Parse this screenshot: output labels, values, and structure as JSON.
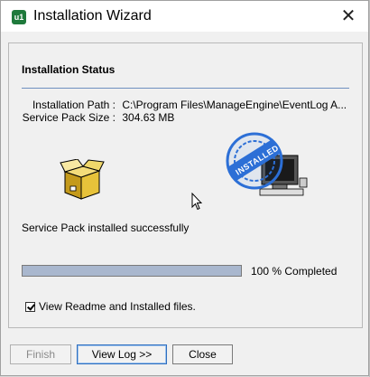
{
  "window": {
    "title": "Installation Wizard",
    "icon": "manageengine-app-icon",
    "icon_glyph": "u1",
    "close_glyph": "✕"
  },
  "section": {
    "title": "Installation Status"
  },
  "info": {
    "path_label": "Installation Path :",
    "path_value": "C:\\Program Files\\ManageEngine\\EventLog A...",
    "size_label": "Service Pack Size :",
    "size_value": "304.63 MB"
  },
  "status": {
    "message": "Service Pack installed successfully",
    "progress_fraction": 1.0,
    "progress_label": "100 % Completed",
    "stamp_text": "INSTALLED"
  },
  "options": {
    "readme_checked": true,
    "readme_label": "View Readme and Installed files."
  },
  "buttons": {
    "finish": "Finish",
    "view_log": "View Log >>",
    "close": "Close"
  },
  "colors": {
    "progress_fill": "#a9b7ce",
    "separator": "#6f8fc0",
    "stamp_blue": "#2c6fd6"
  }
}
